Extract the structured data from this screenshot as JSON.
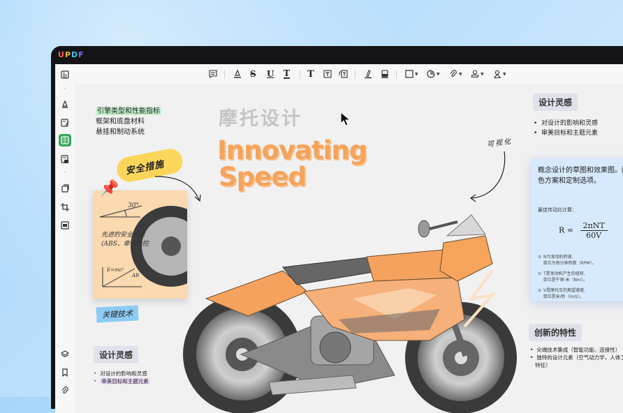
{
  "app": {
    "logo_letters": [
      {
        "ch": "U",
        "color": "#ff5a5f"
      },
      {
        "ch": "P",
        "color": "#ffb22e"
      },
      {
        "ch": "D",
        "color": "#38c8f0"
      },
      {
        "ch": "F",
        "color": "#8a6df7"
      }
    ]
  },
  "sidebar": {
    "items": [
      {
        "icon": "page-view-icon"
      },
      {
        "icon": "highlighter-icon"
      },
      {
        "icon": "edit-text-icon"
      },
      {
        "icon": "organize-pages-icon"
      },
      {
        "icon": "export-icon"
      },
      {
        "icon": "stamp-copy-icon"
      },
      {
        "icon": "crop-icon"
      },
      {
        "icon": "redact-icon"
      },
      {
        "icon": "layers-icon"
      },
      {
        "icon": "bookmark-icon"
      },
      {
        "icon": "attachment-icon"
      }
    ],
    "active_index": 3
  },
  "toolbar": {
    "items": [
      "comment-icon",
      "highlight-icon",
      "strikethrough-icon",
      "underline-icon",
      "squiggly-underline-icon",
      "text-comment-icon",
      "text-box-icon",
      "text-callout-icon",
      "pencil-icon",
      "eraser-icon",
      "shape-icon",
      "sticker-icon",
      "attachment-icon",
      "stamp-icon",
      "signature-icon"
    ],
    "strike_label": "S",
    "underline_label": "U",
    "squiggly_label": "T",
    "textcomment_label": "T"
  },
  "doc": {
    "left_list": [
      "引擎类型和性能指标",
      "框架和底盘材料",
      "悬挂和制动系统"
    ],
    "title_cn": "摩托设计",
    "title_en_line1": "Innovating",
    "title_en_line2": "Speed",
    "sticker_text": "安全措施",
    "sticky_text_1": "先进的安全技术",
    "sticky_text_2": "(ABS、牵引力控",
    "sticky_angle": "30°",
    "sticky_formula": "E=mc²",
    "sticky_ab": "AB",
    "blue_tag": "关键技术",
    "handwritten_right": "可视化",
    "right_tag": "设计灵感",
    "right_bullets": [
      "对设计的影响和灵感",
      "审美目标和主题元素"
    ],
    "card": {
      "desc": "概念设计的草图和效果图。配色方案和定制选项。",
      "label": "最佳传动比计算：",
      "formula_lhs": "R =",
      "formula_num": "2πNT",
      "formula_den": "60V",
      "notes": [
        [
          "N为发动机转速,",
          "单位为每分钟转数（RPM）。"
        ],
        [
          "T是发动机产生的扭矩,",
          "单位是牛顿·米（Nm）。"
        ],
        [
          "V是摩托车的期望速度,",
          "单位是米/秒（m/s）。"
        ]
      ]
    },
    "features_tag": "创新的特性",
    "features": [
      "尖端技术集成（智能功能、连接性）",
      "独特的设计元素（空气动力学，人体工",
      "特征）"
    ],
    "bottom_tag": "设计灵感",
    "bottom_bullets": [
      "对设计的影响和灵感",
      "审美目标和主题元素"
    ]
  },
  "colors": {
    "accent": "#3aa75d",
    "title_orange": "#f6a45c",
    "card_blue": "#d7eafd",
    "sticky": "#fbd9b1"
  }
}
